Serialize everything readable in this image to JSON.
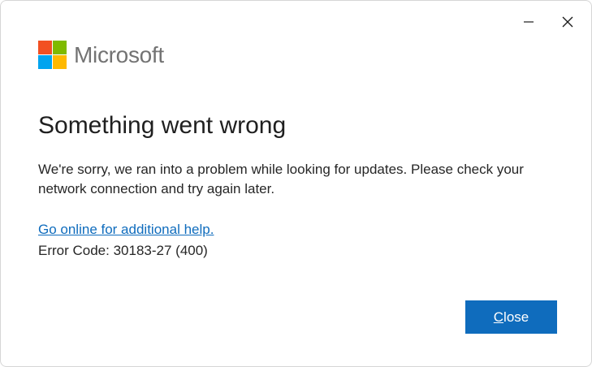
{
  "window": {
    "minimize_icon": "minimize-icon",
    "close_icon": "close-icon"
  },
  "brand": {
    "name": "Microsoft",
    "logo_colors": [
      "#f25022",
      "#7fba00",
      "#00a4ef",
      "#ffb900"
    ]
  },
  "dialog": {
    "title": "Something went wrong",
    "message": "We're sorry, we ran into a problem while looking for updates. Please check your network connection and try again later.",
    "help_link": "Go online for additional help.",
    "error_code": "Error Code: 30183-27 (400)"
  },
  "buttons": {
    "close_mnemonic": "C",
    "close_rest": "lose"
  },
  "colors": {
    "accent": "#0f6cbd",
    "link": "#0f6cbd"
  }
}
